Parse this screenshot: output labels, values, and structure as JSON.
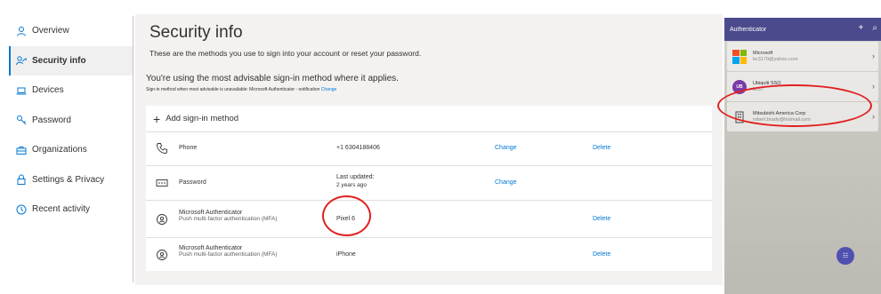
{
  "sidebar": {
    "items": [
      {
        "label": "Overview",
        "icon": "person-icon"
      },
      {
        "label": "Security info",
        "icon": "security-info-icon"
      },
      {
        "label": "Devices",
        "icon": "laptop-icon"
      },
      {
        "label": "Password",
        "icon": "key-icon"
      },
      {
        "label": "Organizations",
        "icon": "briefcase-icon"
      },
      {
        "label": "Settings & Privacy",
        "icon": "lock-icon"
      },
      {
        "label": "Recent activity",
        "icon": "history-icon"
      }
    ]
  },
  "main": {
    "title": "Security info",
    "subtitle": "These are the methods you use to sign into your account or reset your password.",
    "advisable_text": "You're using the most advisable sign-in method where it applies.",
    "signin_note": "Sign-in method when most advisable is unavailable: Microsoft Authenticator - notification",
    "signin_note_link": "Change",
    "add_method_label": "Add sign-in method",
    "methods": [
      {
        "name": "Phone",
        "sub": "",
        "detail": "+1 6304188406",
        "detail_sub": "",
        "change": "Change",
        "delete": "Delete",
        "icon": "phone-icon"
      },
      {
        "name": "Password",
        "sub": "",
        "detail": "Last updated:",
        "detail_sub": "2 years ago",
        "change": "Change",
        "delete": "",
        "icon": "password-dots-icon"
      },
      {
        "name": "Microsoft Authenticator",
        "sub": "Push multi-factor authentication (MFA)",
        "detail": "Pixel 6",
        "detail_sub": "",
        "change": "",
        "delete": "Delete",
        "icon": "authenticator-icon"
      },
      {
        "name": "Microsoft Authenticator",
        "sub": "Push multi-factor authentication (MFA)",
        "detail": "iPhone",
        "detail_sub": "",
        "change": "",
        "delete": "Delete",
        "icon": "authenticator-icon"
      }
    ]
  },
  "phone": {
    "app_title": "Authenticator",
    "accounts": [
      {
        "name": "Microsoft",
        "email": "bc3179@yahoo.com"
      },
      {
        "name": "Ubiquiti SSO",
        "email": "bc37"
      },
      {
        "name": "Mitsubishi America Corp",
        "email": "robert.brady@hotmail.com"
      }
    ],
    "ub_initials": "UB"
  },
  "colors": {
    "accent": "#0078d4",
    "annotation": "#e02020",
    "phone_header": "#4a4a8c"
  }
}
